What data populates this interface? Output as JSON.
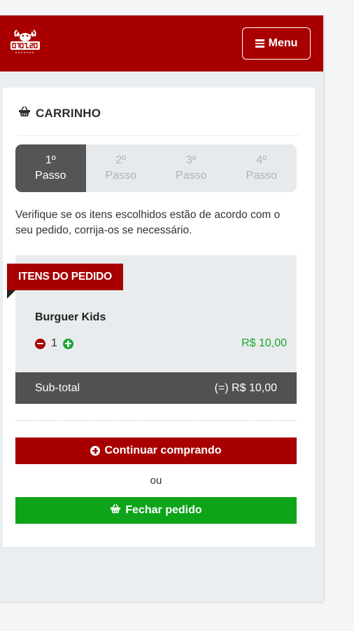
{
  "header": {
    "menu_label": "Menu",
    "logo_icon": "lobster-logo-icon",
    "colors": {
      "brand": "#a80000"
    }
  },
  "cart": {
    "title": "CARRINHO",
    "icon": "basket-icon"
  },
  "steps": [
    {
      "number": "1º",
      "label": "Passo",
      "active": true
    },
    {
      "number": "2º",
      "label": "Passo",
      "active": false
    },
    {
      "number": "3º",
      "label": "Passo",
      "active": false
    },
    {
      "number": "4º",
      "label": "Passo",
      "active": false
    }
  ],
  "description": "Verifique se os itens escolhidos estão de acordo com o seu pedido, corrija-os se necessário.",
  "order": {
    "section_label": "ITENS DO PEDIDO",
    "items": [
      {
        "name": "Burguer Kids",
        "quantity": "1",
        "price": "R$ 10,00"
      }
    ],
    "subtotal_label": "Sub-total",
    "subtotal_value": "(=) R$ 10,00"
  },
  "actions": {
    "continue_label": "Continuar comprando",
    "or_label": "ou",
    "close_label": "Fechar pedido",
    "colors": {
      "continue": "#a80000",
      "close": "#0ea419"
    }
  }
}
